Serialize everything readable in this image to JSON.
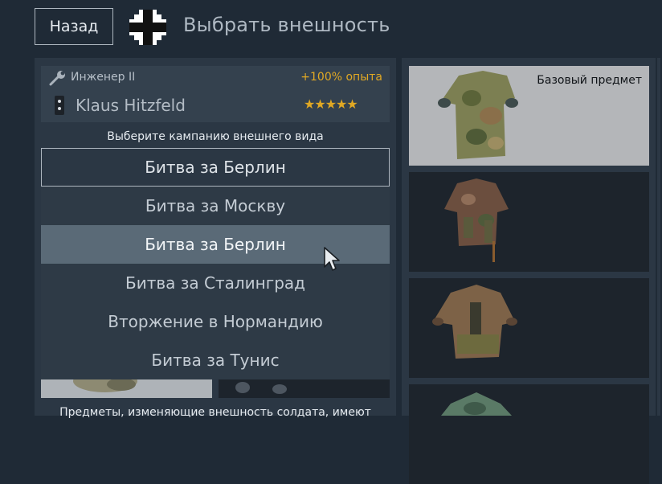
{
  "header": {
    "back_label": "Назад",
    "title": "Выбрать внешность",
    "nation_icon": "balkenkreuz-icon"
  },
  "soldier": {
    "class_label": "Инженер II",
    "exp_bonus": "+100% опыта",
    "name": "Klaus Hitzfeld",
    "stars": "★★★★★",
    "rating": 5,
    "class_icon": "wrench-icon",
    "rank_icon": "rank-insignia-icon"
  },
  "campaign": {
    "hint": "Выберите кампанию внешнего вида",
    "current": "Битва за Берлин",
    "options": [
      "Битва за Москву",
      "Битва за Берлин",
      "Битва за Сталинград",
      "Вторжение в Нормандию",
      "Битва за Тунис"
    ],
    "selected_index": 1
  },
  "footer": {
    "note": "Предметы, изменяющие внешность солдата, имеют"
  },
  "items": {
    "base_label": "Базовый предмет"
  },
  "colors": {
    "background": "#1f2a36",
    "panel": "#2b3744",
    "accent_gold": "#e0a824",
    "selected_row": "#5a6a77"
  }
}
